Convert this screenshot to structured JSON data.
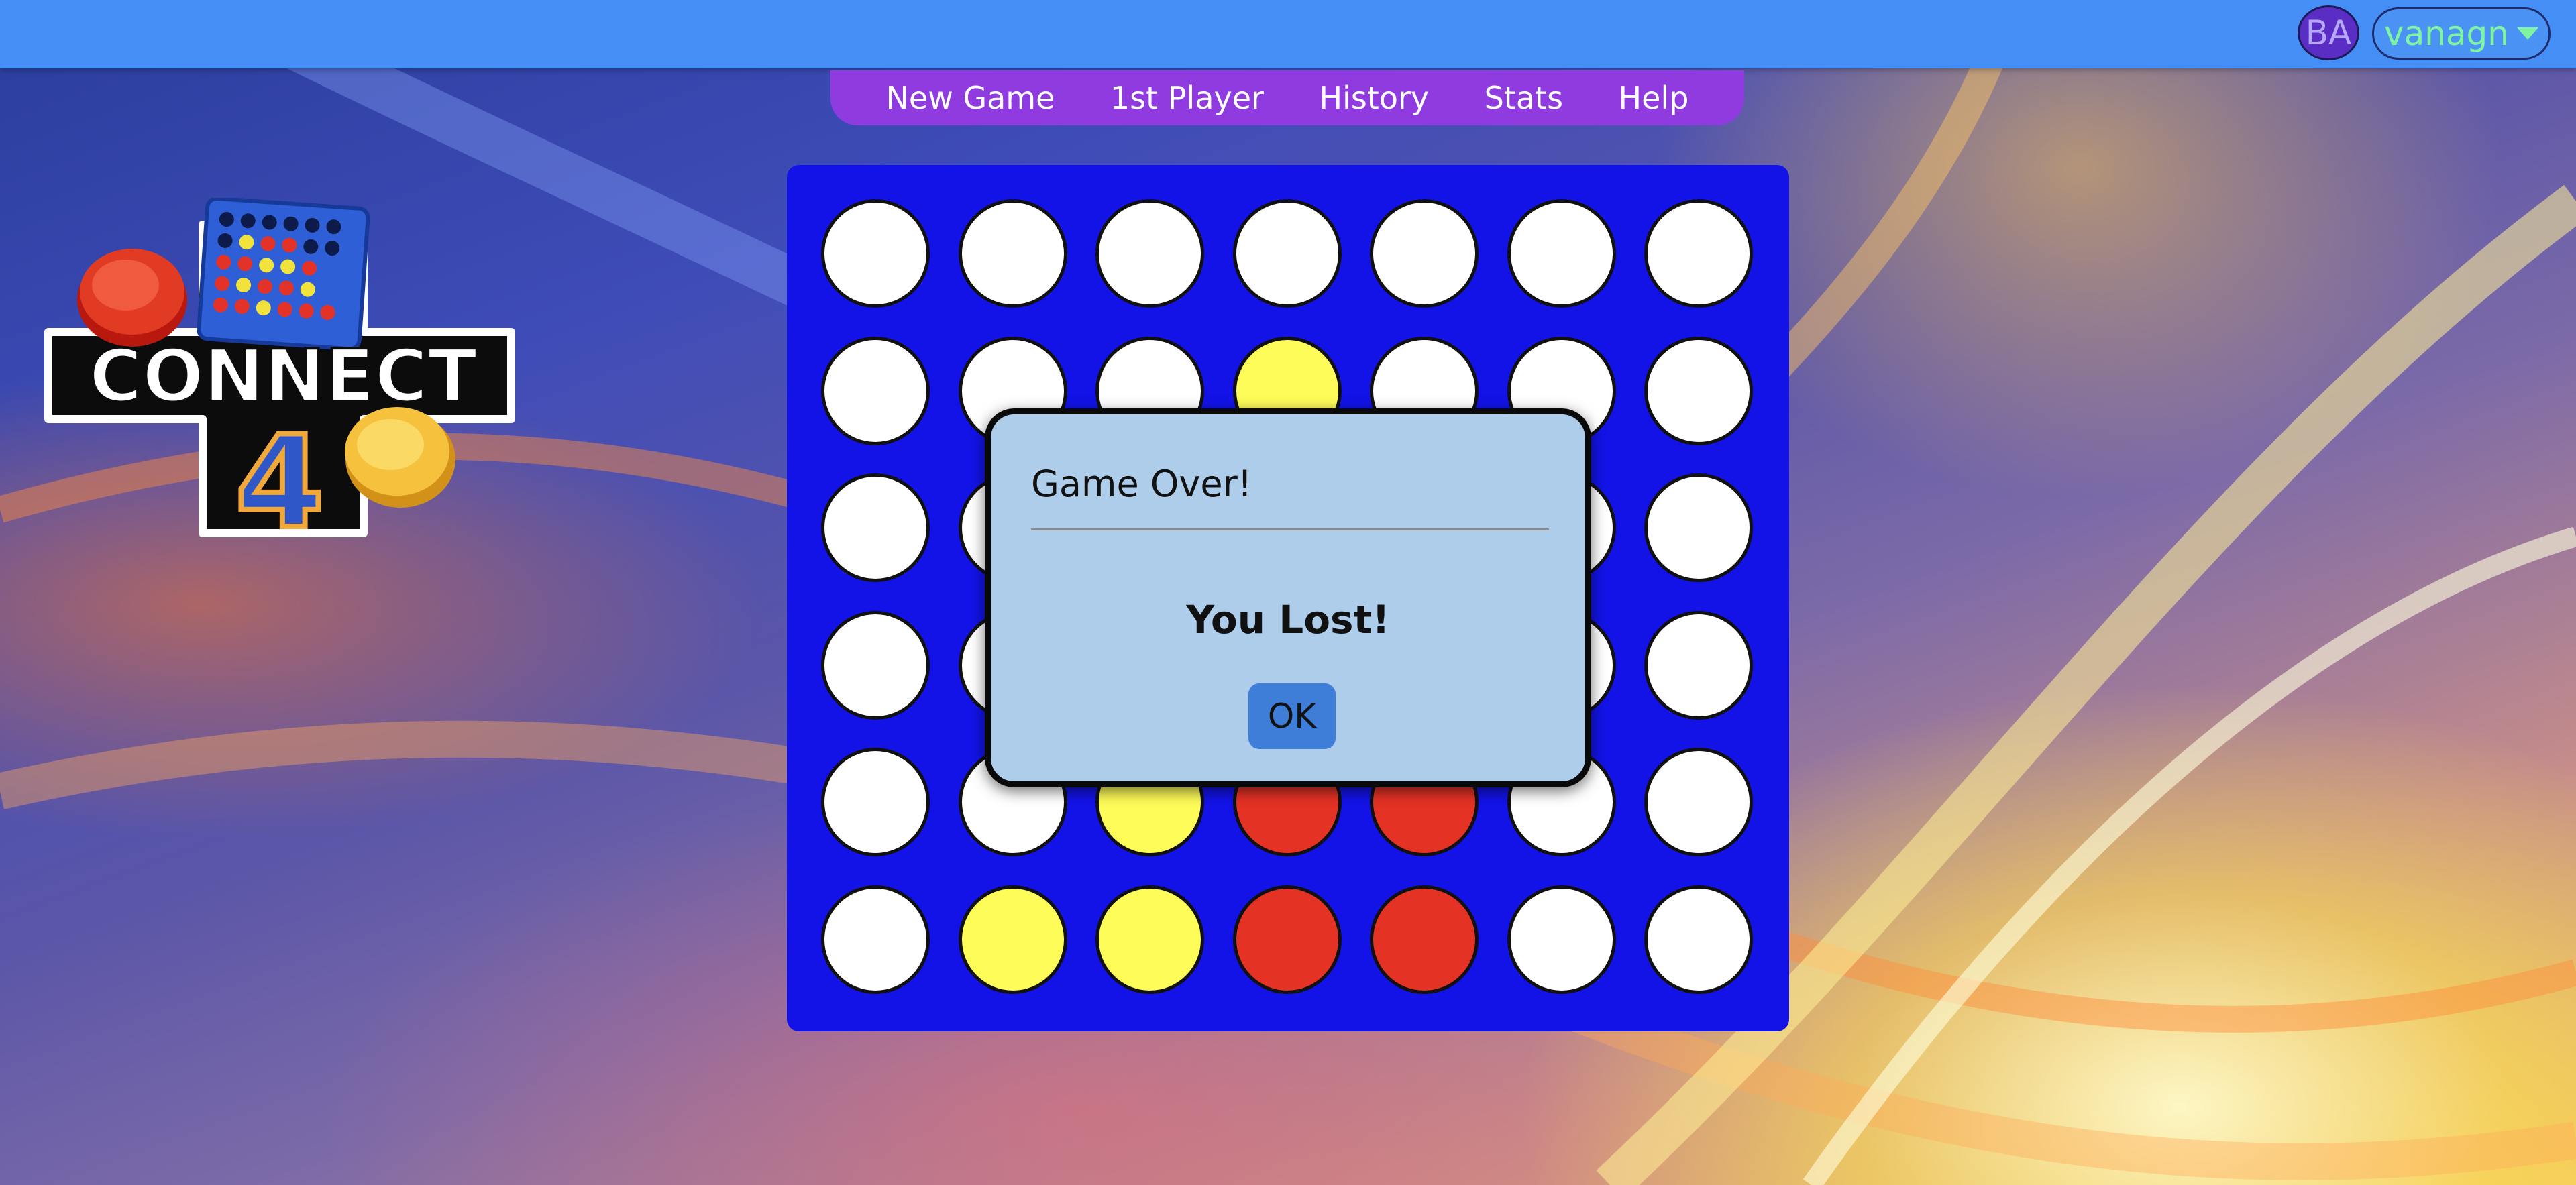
{
  "header": {
    "avatar_initials": "BA",
    "username": "vanagn"
  },
  "menu": {
    "items": [
      "New Game",
      "1st Player",
      "History",
      "Stats",
      "Help"
    ]
  },
  "logo": {
    "text": "CONNECT",
    "number": "4"
  },
  "board": {
    "rows": 6,
    "cols": 7,
    "cells": [
      [
        "empty",
        "empty",
        "empty",
        "empty",
        "empty",
        "empty",
        "empty"
      ],
      [
        "empty",
        "empty",
        "empty",
        "yellow",
        "empty",
        "empty",
        "empty"
      ],
      [
        "empty",
        "empty",
        "empty",
        "empty",
        "empty",
        "empty",
        "empty"
      ],
      [
        "empty",
        "empty",
        "empty",
        "empty",
        "empty",
        "empty",
        "empty"
      ],
      [
        "empty",
        "empty",
        "yellow",
        "red",
        "red",
        "empty",
        "empty"
      ],
      [
        "empty",
        "yellow",
        "yellow",
        "red",
        "red",
        "empty",
        "empty"
      ]
    ]
  },
  "dialog": {
    "title": "Game Over!",
    "message": "You Lost!",
    "ok_label": "OK"
  },
  "colors": {
    "topbar": "#448ef6",
    "menu": "#8f3be0",
    "board": "#1313e8",
    "yellow_piece": "#fdfc58",
    "red_piece": "#e43224",
    "dialog_bg": "#aecdeb",
    "ok_button": "#3e7ed8"
  }
}
